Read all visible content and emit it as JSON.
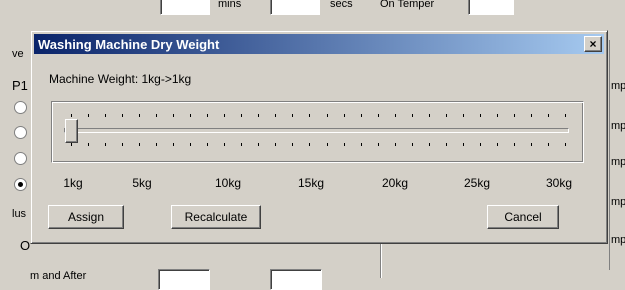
{
  "dialog": {
    "title": "Washing Machine Dry Weight",
    "close_glyph": "×",
    "weight_label": "Machine Weight: 1kg->1kg",
    "slider": {
      "min": 1,
      "max": 30,
      "value": 1,
      "unit": "kg"
    },
    "scale_labels": [
      "1kg",
      "5kg",
      "10kg",
      "15kg",
      "20kg",
      "25kg",
      "30kg"
    ],
    "buttons": {
      "assign": "Assign",
      "recalculate": "Recalculate",
      "cancel": "Cancel"
    }
  },
  "background": {
    "top_text_1": "mins",
    "top_text_2": "secs",
    "top_text_3": "On Temper",
    "left_frag_1": "ve",
    "left_frag_2": "P1",
    "left_frag_3": "lus",
    "left_frag_4": "O",
    "bottom_frag": "m and After",
    "right_frags": [
      "mp",
      "mp",
      "mp",
      "mp",
      "mp"
    ]
  }
}
